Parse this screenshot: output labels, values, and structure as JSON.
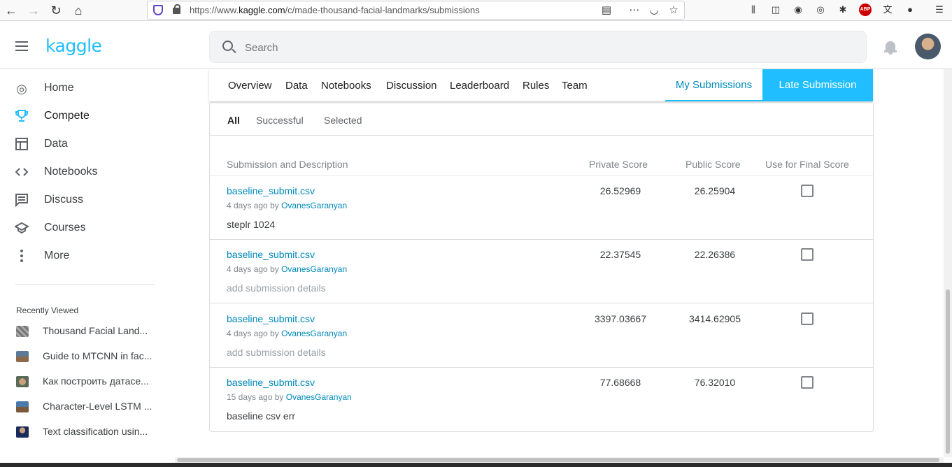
{
  "browser": {
    "url_prefix": "https://www.",
    "url_domain": "kaggle.com",
    "url_path": "/c/made-thousand-facial-landmarks/submissions",
    "icons": [
      "back-icon",
      "forward-icon",
      "reload-icon",
      "home-icon",
      "reader-icon",
      "more-icon",
      "pocket-icon",
      "bookmark-star-icon",
      "library-icon",
      "sidebar-icon",
      "account-icon",
      "sync-icon",
      "extension-icon",
      "adblock-icon",
      "translate-icon",
      "extension2-icon",
      "menu-icon"
    ],
    "abp_label": "ABP"
  },
  "header": {
    "logo": "kaggle",
    "search_placeholder": "Search"
  },
  "sidebar": {
    "items": [
      {
        "label": "Home",
        "icon": "compass-icon",
        "glyph": "◎"
      },
      {
        "label": "Compete",
        "icon": "trophy-icon",
        "glyph": "🏆"
      },
      {
        "label": "Data",
        "icon": "table-icon",
        "glyph": "▦"
      },
      {
        "label": "Notebooks",
        "icon": "code-icon",
        "glyph": "‹›"
      },
      {
        "label": "Discuss",
        "icon": "comment-icon",
        "glyph": "▤"
      },
      {
        "label": "Courses",
        "icon": "school-icon",
        "glyph": "🎓"
      },
      {
        "label": "More",
        "icon": "more-vert-icon",
        "glyph": "⋮"
      }
    ],
    "recent_title": "Recently Viewed",
    "recent": [
      {
        "label": "Thousand Facial Land...",
        "color": "#8a8a8a"
      },
      {
        "label": "Guide to MTCNN in fac...",
        "color": "#5b7a9a"
      },
      {
        "label": "Как построить датасе...",
        "color": "#7a8a6a"
      },
      {
        "label": "Character-Level LSTM ...",
        "color": "#4a7aaa"
      },
      {
        "label": "Text classification usin...",
        "color": "#2a3a6a"
      }
    ]
  },
  "tabs": {
    "items": [
      "Overview",
      "Data",
      "Notebooks",
      "Discussion",
      "Leaderboard",
      "Rules",
      "Team"
    ],
    "my_submissions": "My Submissions",
    "late_submission": "Late Submission"
  },
  "filters": [
    "All",
    "Successful",
    "Selected"
  ],
  "columns": {
    "submission": "Submission and Description",
    "private": "Private Score",
    "public": "Public Score",
    "final": "Use for Final Score"
  },
  "submissions": [
    {
      "file": "baseline_submit.csv",
      "age": "4 days ago",
      "by": "by",
      "user": "OvanesGaranyan",
      "desc": "steplr 1024",
      "private": "26.52969",
      "public": "26.25904",
      "selected": false
    },
    {
      "file": "baseline_submit.csv",
      "age": "4 days ago",
      "by": "by",
      "user": "OvanesGaranyan",
      "desc": "add submission details",
      "private": "22.37545",
      "public": "22.26386",
      "selected": false
    },
    {
      "file": "baseline_submit.csv",
      "age": "4 days ago",
      "by": "by",
      "user": "OvanesGaranyan",
      "desc": "add submission details",
      "private": "3397.03667",
      "public": "3414.62905",
      "selected": false
    },
    {
      "file": "baseline_submit.csv",
      "age": "15 days ago",
      "by": "by",
      "user": "OvanesGaranyan",
      "desc": "baseline csv err",
      "private": "77.68668",
      "public": "76.32010",
      "selected": false
    }
  ],
  "colors": {
    "accent": "#20beff",
    "link": "#008abc"
  }
}
